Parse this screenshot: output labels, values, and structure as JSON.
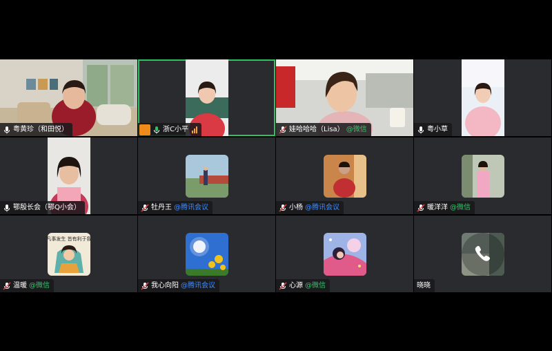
{
  "participants": [
    {
      "name": "粤黄珍（和田悦）",
      "source": "",
      "mic": "on"
    },
    {
      "name": "浙C小平",
      "source": "",
      "mic": "on",
      "active": true
    },
    {
      "name": "娃哈哈哈（Lisa）",
      "source": "@微信",
      "mic": "muted"
    },
    {
      "name": "粤小草",
      "source": "",
      "mic": "on"
    },
    {
      "name": "鄂殷长会（鄂Q小会）",
      "source": "",
      "mic": "on"
    },
    {
      "name": "牡丹王",
      "source": "@腾讯会议",
      "mic": "muted"
    },
    {
      "name": "小杨",
      "source": "@腾讯会议",
      "mic": "muted"
    },
    {
      "name": "暖洋洋",
      "source": "@微信",
      "mic": "muted"
    },
    {
      "name": "温暖",
      "source": "@微信",
      "mic": "muted"
    },
    {
      "name": "我心向阳",
      "source": "@腾讯会议",
      "mic": "muted"
    },
    {
      "name": "心源",
      "source": "@微信",
      "mic": "muted"
    },
    {
      "name": "晓晓",
      "source": "",
      "mic": "none"
    }
  ],
  "avatar_text": {
    "p9": "凡事发生 皆有利于我"
  },
  "colors": {
    "active_border": "#2ec262",
    "wechat": "#35c46b",
    "tencent": "#3d8cff",
    "tile_bg": "#2a2b2e"
  }
}
